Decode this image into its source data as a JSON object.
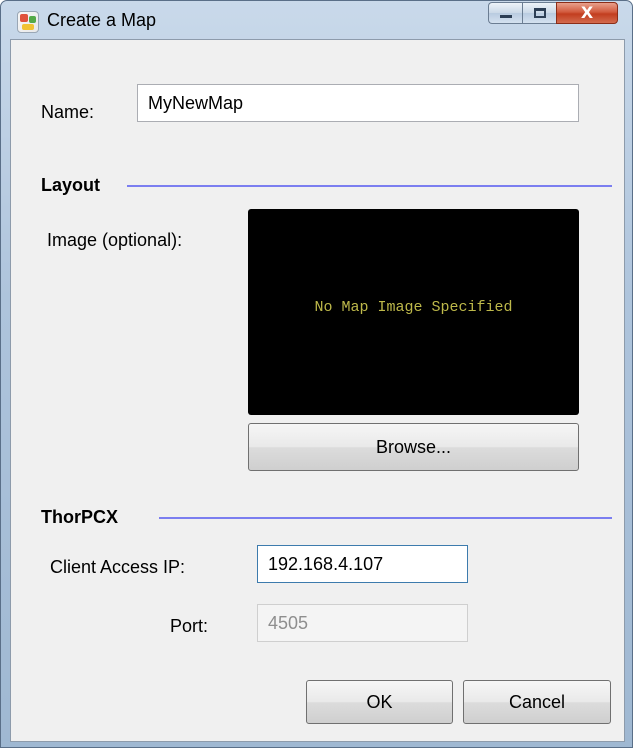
{
  "window": {
    "title": "Create a Map",
    "close_glyph": "X"
  },
  "name_field": {
    "label": "Name:",
    "value": "MyNewMap"
  },
  "layout_section": {
    "title": "Layout",
    "image_label": "Image (optional):",
    "image_placeholder": "No Map Image Specified",
    "browse_button": "Browse..."
  },
  "thorpcx_section": {
    "title": "ThorPCX",
    "client_ip_label": "Client Access IP:",
    "client_ip_value": "192.168.4.107",
    "port_label": "Port:",
    "port_value": "4505"
  },
  "footer": {
    "ok_button": "OK",
    "cancel_button": "Cancel"
  },
  "colors": {
    "section_line": "#7b7ef0",
    "image_text": "#bdb84a"
  }
}
